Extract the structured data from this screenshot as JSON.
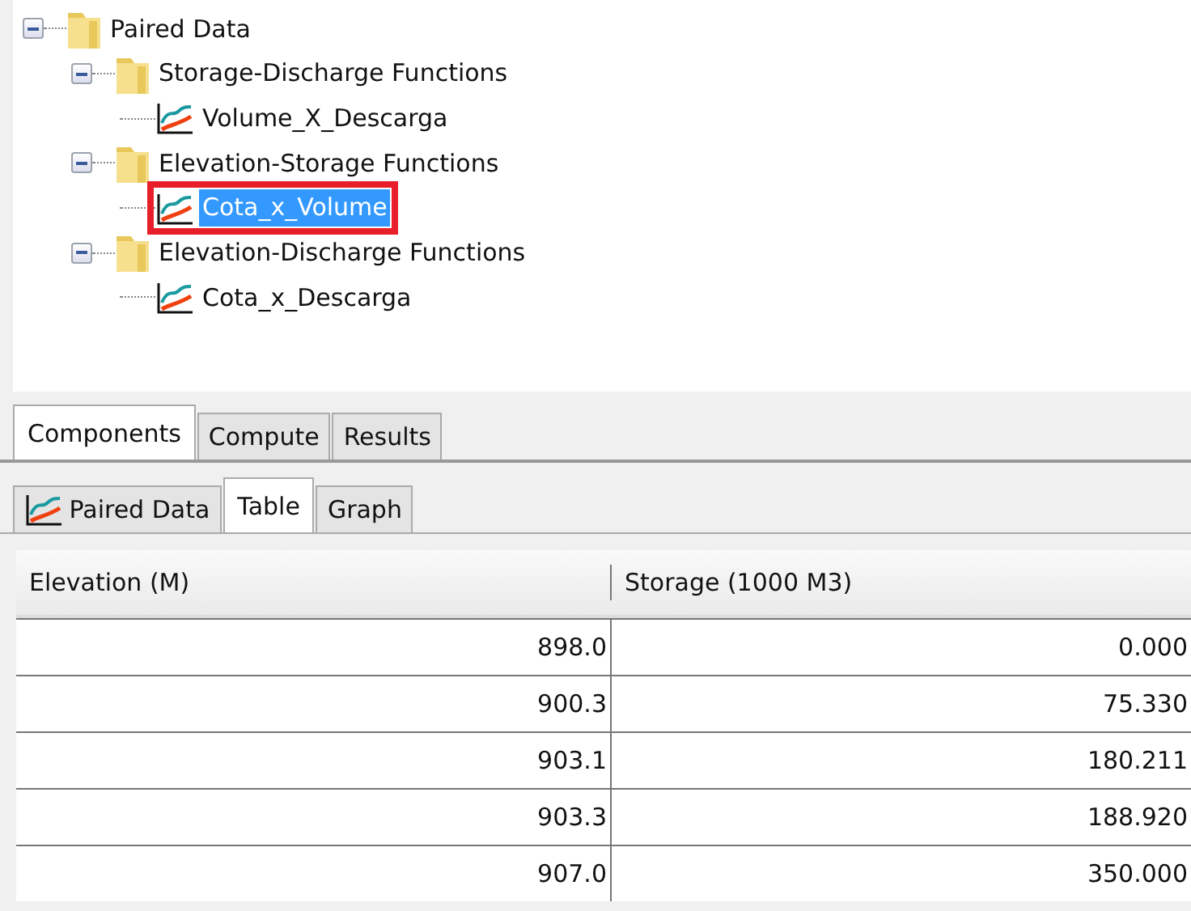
{
  "tree": [
    {
      "label": "Paired Data",
      "kind": "folder",
      "expanded": true,
      "selected": false,
      "children": [
        {
          "label": "Storage-Discharge Functions",
          "kind": "folder",
          "expanded": true,
          "selected": false,
          "children": [
            {
              "label": "Volume_X_Descarga",
              "kind": "paired-data",
              "selected": false,
              "highlighted": false
            }
          ]
        },
        {
          "label": "Elevation-Storage Functions",
          "kind": "folder",
          "expanded": true,
          "selected": false,
          "children": [
            {
              "label": "Cota_x_Volume",
              "kind": "paired-data",
              "selected": true,
              "highlighted": true
            }
          ]
        },
        {
          "label": "Elevation-Discharge Functions",
          "kind": "folder",
          "expanded": true,
          "selected": false,
          "children": [
            {
              "label": "Cota_x_Descarga",
              "kind": "paired-data",
              "selected": false,
              "highlighted": false
            }
          ]
        }
      ]
    }
  ],
  "main_tabs": [
    {
      "label": "Components",
      "selected": true
    },
    {
      "label": "Compute",
      "selected": false
    },
    {
      "label": "Results",
      "selected": false
    }
  ],
  "sub_tabs": [
    {
      "label": "Paired Data",
      "kind": "paired-data",
      "selected": false
    },
    {
      "label": "Table",
      "kind": "plain",
      "selected": true
    },
    {
      "label": "Graph",
      "kind": "plain",
      "selected": false
    }
  ],
  "table": {
    "columns": [
      "Elevation (M)",
      "Storage (1000 M3)"
    ],
    "rows": [
      [
        "898.0",
        "0.000"
      ],
      [
        "900.3",
        "75.330"
      ],
      [
        "903.1",
        "180.211"
      ],
      [
        "903.3",
        "188.920"
      ],
      [
        "907.0",
        "350.000"
      ]
    ]
  }
}
